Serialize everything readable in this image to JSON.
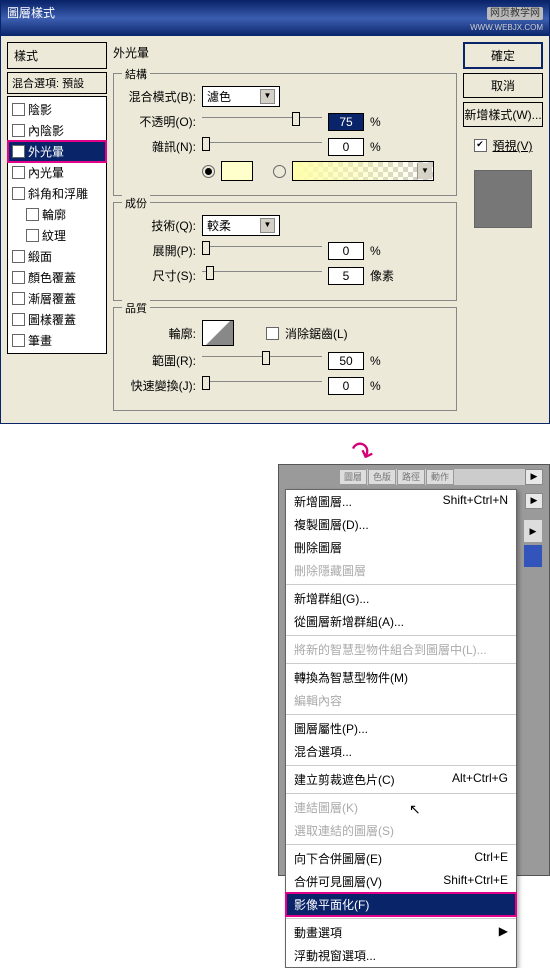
{
  "dialog": {
    "title": "圖層樣式",
    "watermark": "网页教学网",
    "watermark_url": "WWW.WEBJX.COM",
    "left": {
      "title": "樣式",
      "sub": "混合選項: 預設",
      "items": [
        {
          "label": "陰影"
        },
        {
          "label": "內陰影"
        },
        {
          "label": "外光暈",
          "sel": true,
          "check": true
        },
        {
          "label": "內光暈"
        },
        {
          "label": "斜角和浮雕"
        },
        {
          "label": "輪廓",
          "indent": true
        },
        {
          "label": "紋理",
          "indent": true
        },
        {
          "label": "緞面"
        },
        {
          "label": "顏色覆蓋"
        },
        {
          "label": "漸層覆蓋"
        },
        {
          "label": "圖樣覆蓋"
        },
        {
          "label": "筆畫"
        }
      ]
    },
    "outerGlow": {
      "title": "外光暈",
      "structure": {
        "legend": "結構",
        "blend_label": "混合模式(B):",
        "blend_value": "濾色",
        "opacity_label": "不透明(O):",
        "opacity_value": "75",
        "opacity_unit": "%",
        "noise_label": "雜訊(N):",
        "noise_value": "0",
        "noise_unit": "%"
      },
      "elements": {
        "legend": "成份",
        "tech_label": "技術(Q):",
        "tech_value": "較柔",
        "spread_label": "展開(P):",
        "spread_value": "0",
        "spread_unit": "%",
        "size_label": "尺寸(S):",
        "size_value": "5",
        "size_unit": "像素"
      },
      "quality": {
        "legend": "品質",
        "contour_label": "輪廓:",
        "anti_label": "消除鋸齒(L)",
        "range_label": "範圍(R):",
        "range_value": "50",
        "range_unit": "%",
        "jitter_label": "快速變換(J):",
        "jitter_value": "0",
        "jitter_unit": "%"
      }
    },
    "right": {
      "ok": "確定",
      "cancel": "取消",
      "newstyle": "新增樣式(W)...",
      "preview": "預視(V)"
    }
  },
  "menu": {
    "tabs": [
      "圖層",
      "色版",
      "路徑",
      "動作"
    ],
    "g1": [
      {
        "l": "新增圖層...",
        "s": "Shift+Ctrl+N"
      },
      {
        "l": "複製圖層(D)..."
      },
      {
        "l": "刪除圖層"
      },
      {
        "l": "刪除隱藏圖層",
        "dis": true
      }
    ],
    "g2": [
      {
        "l": "新增群組(G)..."
      },
      {
        "l": "從圖層新增群組(A)..."
      }
    ],
    "g3": [
      {
        "l": "將新的智慧型物件組合到圖層中(L)...",
        "dis": true
      }
    ],
    "g4": [
      {
        "l": "轉換為智慧型物件(M)"
      },
      {
        "l": "編輯內容",
        "dis": true
      }
    ],
    "g5": [
      {
        "l": "圖層屬性(P)..."
      },
      {
        "l": "混合選項..."
      }
    ],
    "g6": [
      {
        "l": "建立剪裁遮色片(C)",
        "s": "Alt+Ctrl+G"
      }
    ],
    "g7": [
      {
        "l": "連結圖層(K)",
        "dis": true
      },
      {
        "l": "選取連結的圖層(S)",
        "dis": true
      }
    ],
    "g8": [
      {
        "l": "向下合併圖層(E)",
        "s": "Ctrl+E"
      },
      {
        "l": "合併可見圖層(V)",
        "s": "Shift+Ctrl+E"
      },
      {
        "l": "影像平面化(F)",
        "sel": true
      }
    ],
    "g9": [
      {
        "l": "動畫選項",
        "arrow": true
      },
      {
        "l": "浮動視窗選項..."
      }
    ]
  }
}
